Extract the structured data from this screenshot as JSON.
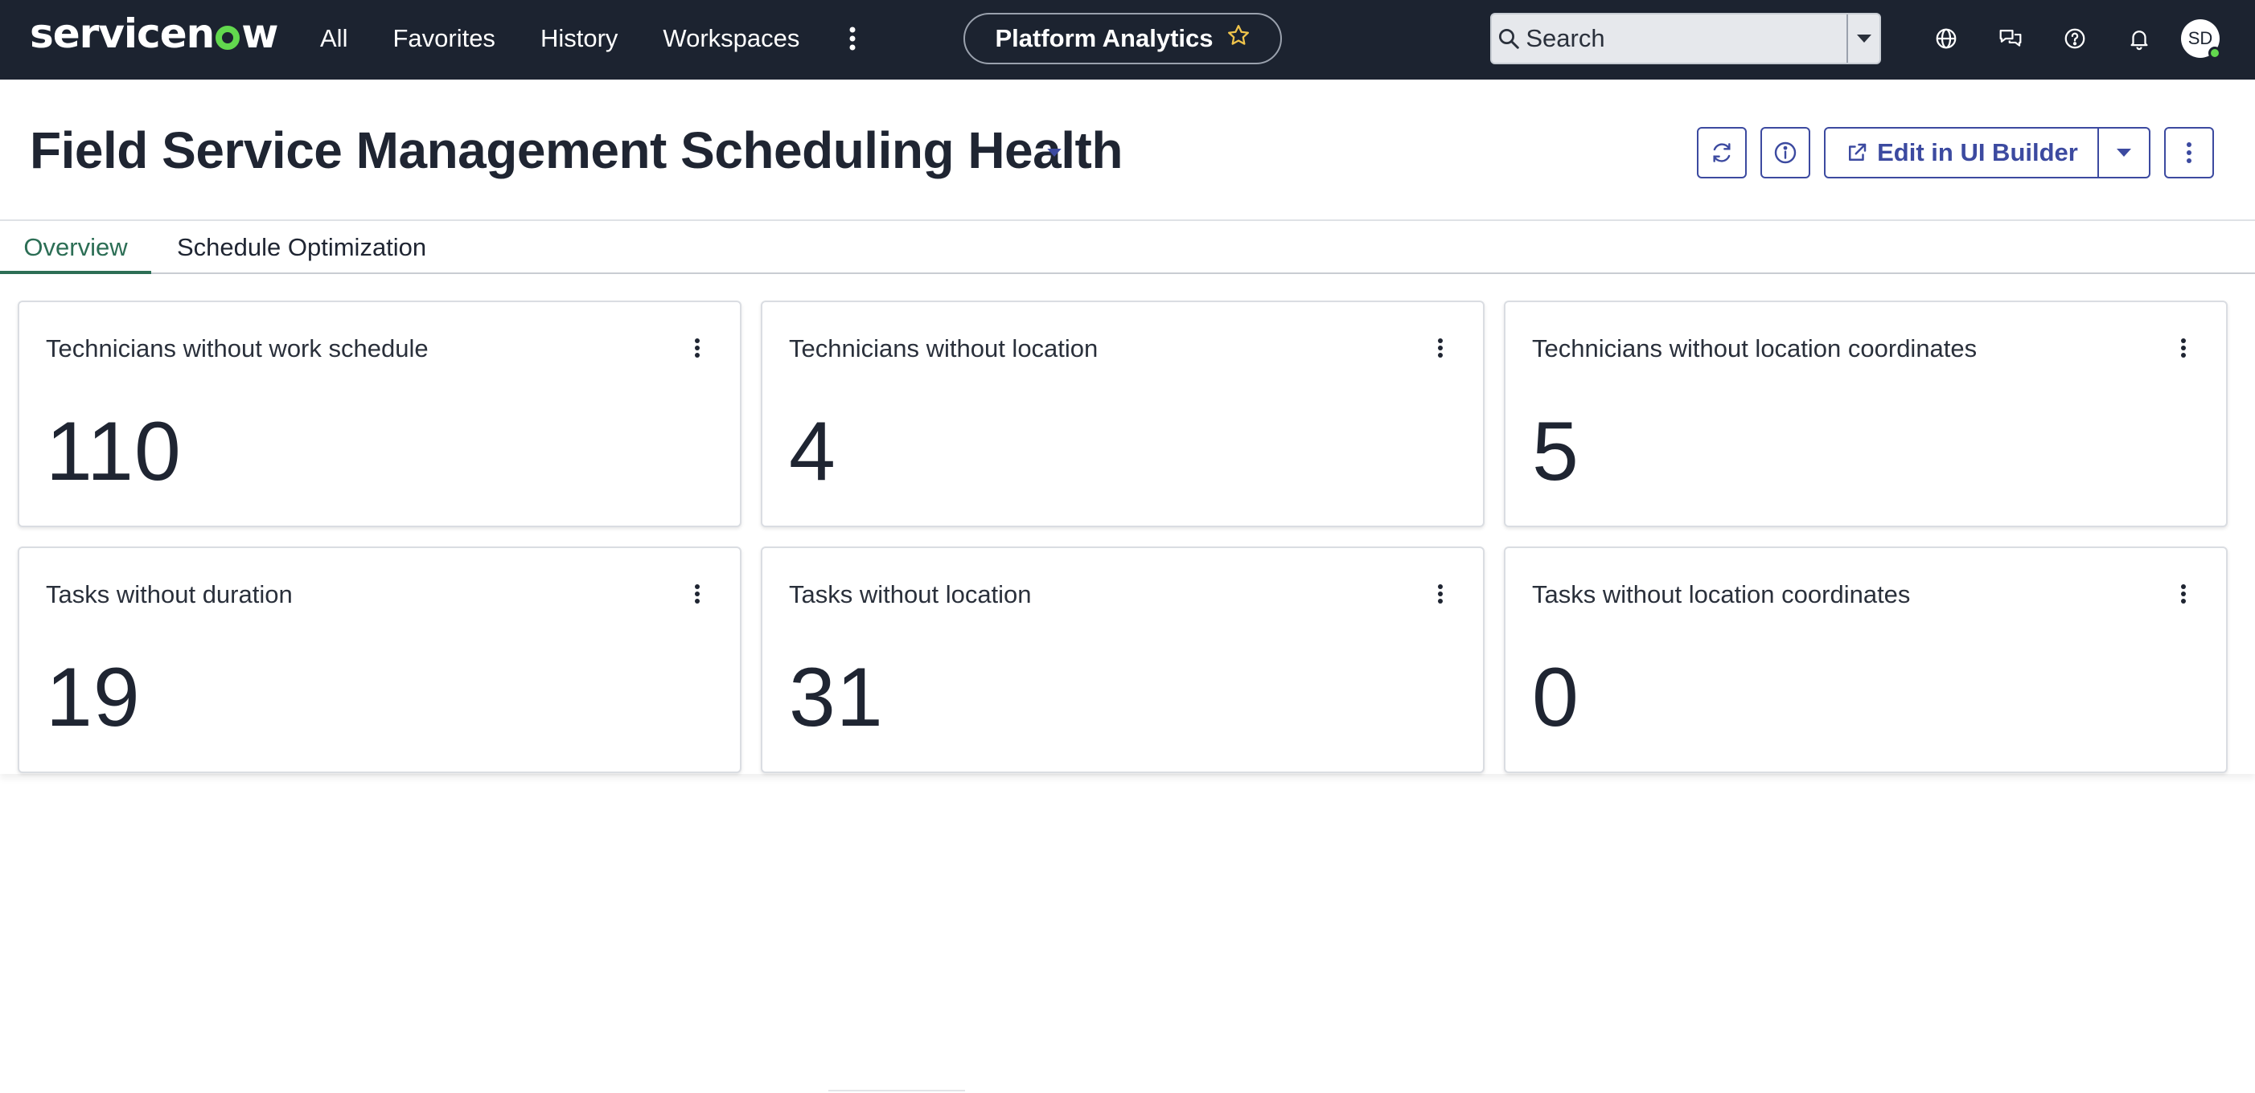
{
  "topnav": {
    "logo_text_a": "servicen",
    "logo_text_b": "w",
    "links": [
      "All",
      "Favorites",
      "History",
      "Workspaces"
    ],
    "context_pill": "Platform Analytics",
    "search_placeholder": "Search",
    "avatar_initials": "SD",
    "colors": {
      "bar": "#1c2330",
      "logo_accent": "#62d84e",
      "star": "#f0c44b"
    }
  },
  "header": {
    "title": "Field Service Management Scheduling Health",
    "edit_button_label": "Edit in UI Builder",
    "accent_color": "#3c4aa0"
  },
  "tabs": [
    {
      "label": "Overview",
      "active": true
    },
    {
      "label": "Schedule Optimization",
      "active": false
    }
  ],
  "tab_active_color": "#2c6e55",
  "cards": [
    {
      "title": "Technicians without work schedule",
      "value": "110"
    },
    {
      "title": "Technicians without location",
      "value": "4"
    },
    {
      "title": "Technicians without location coordinates",
      "value": "5"
    },
    {
      "title": "Tasks without duration",
      "value": "19"
    },
    {
      "title": "Tasks without location",
      "value": "31"
    },
    {
      "title": "Tasks without location coordinates",
      "value": "0"
    }
  ]
}
